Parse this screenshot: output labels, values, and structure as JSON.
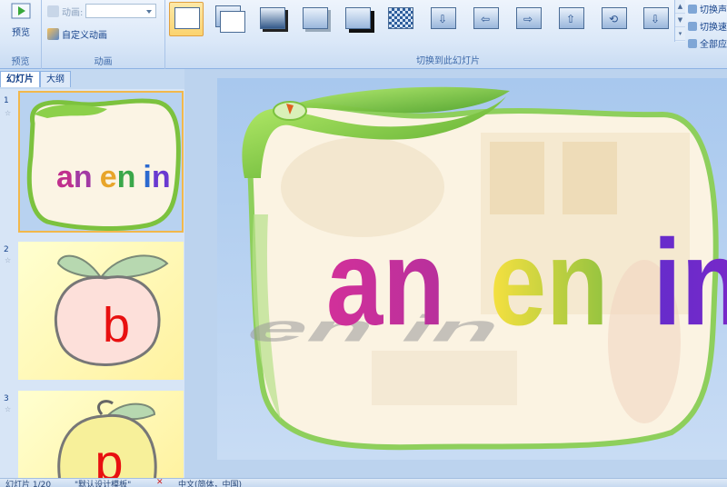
{
  "ribbon": {
    "preview_group": {
      "button_label": "预览",
      "group_label": "预览"
    },
    "animation_group": {
      "animation_label": "动画:",
      "custom_animation_label": "自定义动画",
      "group_label": "动画"
    },
    "transition_group": {
      "group_label": "切换到此幻灯片"
    },
    "right_options": [
      "切换声",
      "切换速",
      "全部应"
    ]
  },
  "left_panel": {
    "tabs": [
      "幻灯片",
      "大纲"
    ],
    "close_glyph": "×",
    "slides": [
      {
        "number": "1",
        "text": "an en in"
      },
      {
        "number": "2",
        "text": "b"
      },
      {
        "number": "3",
        "text": "p"
      }
    ]
  },
  "slide": {
    "title_words": [
      "an",
      "en",
      "in"
    ]
  },
  "status_bar": {
    "slide_counter": "幻灯片 1/20",
    "theme": "\"默认设计模板\"",
    "language": "中文(简体，中国)"
  },
  "colors": {
    "ribbon_bg": "#dbe8f8",
    "selected_thumb": "#fbd36f",
    "apple_green": "#7cc23e",
    "slide_bg": "#b8d2f0"
  }
}
